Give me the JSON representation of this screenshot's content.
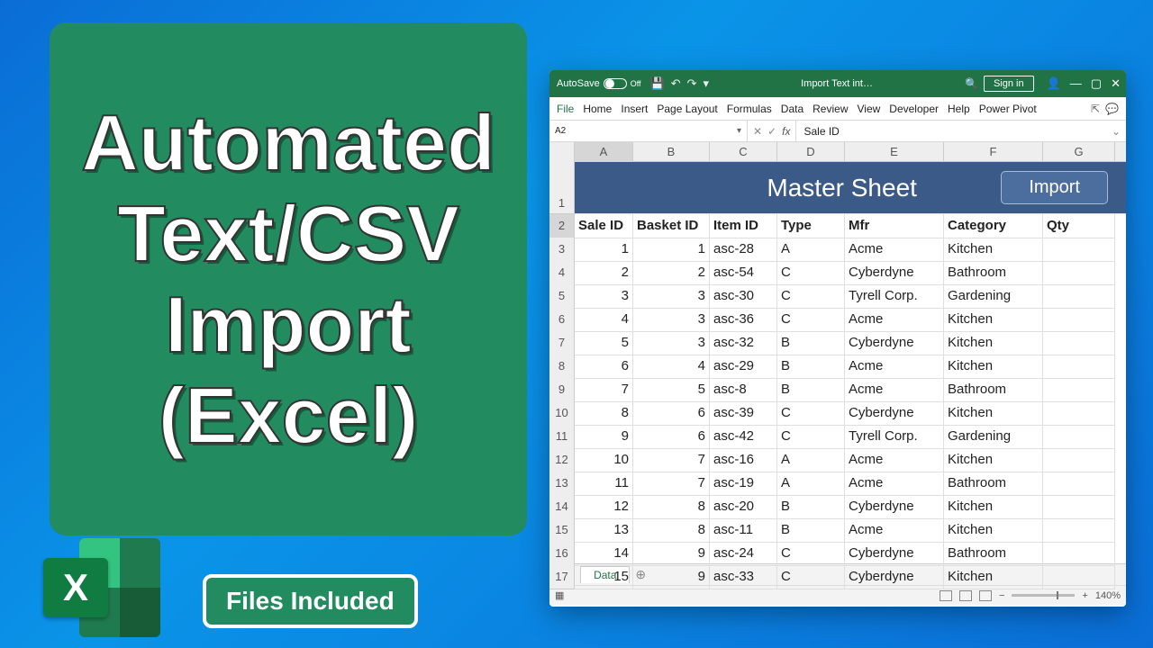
{
  "title_card": {
    "lines": [
      "Automated",
      "Text/CSV",
      "Import",
      "(Excel)"
    ]
  },
  "files_badge": "Files Included",
  "excel_logo_letter": "X",
  "excel": {
    "titlebar": {
      "autosave_label": "AutoSave",
      "autosave_state": "Off",
      "filename": "Import Text int…",
      "search_icon": "🔍",
      "signin": "Sign in",
      "qat": {
        "save": "💾",
        "undo": "↶",
        "redo": "↷",
        "more": "▾"
      },
      "win": {
        "user": "👤",
        "min": "—",
        "max": "▢",
        "close": "✕"
      }
    },
    "tabs": [
      "File",
      "Home",
      "Insert",
      "Page Layout",
      "Formulas",
      "Data",
      "Review",
      "View",
      "Developer",
      "Help",
      "Power Pivot"
    ],
    "formula": {
      "name_box": "A2",
      "fx_cancel": "✕",
      "fx_ok": "✓",
      "fx": "fx",
      "value": "Sale ID"
    },
    "columns": [
      "A",
      "B",
      "C",
      "D",
      "E",
      "F",
      "G"
    ],
    "master": {
      "title": "Master Sheet",
      "import": "Import"
    },
    "headers": [
      "Sale ID",
      "Basket ID",
      "Item ID",
      "Type",
      "Mfr",
      "Category",
      "Qty"
    ],
    "rows": [
      [
        "1",
        "1",
        "asc-28",
        "A",
        "Acme",
        "Kitchen",
        ""
      ],
      [
        "2",
        "2",
        "asc-54",
        "C",
        "Cyberdyne",
        "Bathroom",
        ""
      ],
      [
        "3",
        "3",
        "asc-30",
        "C",
        "Tyrell Corp.",
        "Gardening",
        ""
      ],
      [
        "4",
        "3",
        "asc-36",
        "C",
        "Acme",
        "Kitchen",
        ""
      ],
      [
        "5",
        "3",
        "asc-32",
        "B",
        "Cyberdyne",
        "Kitchen",
        ""
      ],
      [
        "6",
        "4",
        "asc-29",
        "B",
        "Acme",
        "Kitchen",
        ""
      ],
      [
        "7",
        "5",
        "asc-8",
        "B",
        "Acme",
        "Bathroom",
        ""
      ],
      [
        "8",
        "6",
        "asc-39",
        "C",
        "Cyberdyne",
        "Kitchen",
        ""
      ],
      [
        "9",
        "6",
        "asc-42",
        "C",
        "Tyrell Corp.",
        "Gardening",
        ""
      ],
      [
        "10",
        "7",
        "asc-16",
        "A",
        "Acme",
        "Kitchen",
        ""
      ],
      [
        "11",
        "7",
        "asc-19",
        "A",
        "Acme",
        "Bathroom",
        ""
      ],
      [
        "12",
        "8",
        "asc-20",
        "B",
        "Cyberdyne",
        "Kitchen",
        ""
      ],
      [
        "13",
        "8",
        "asc-11",
        "B",
        "Acme",
        "Kitchen",
        ""
      ],
      [
        "14",
        "9",
        "asc-24",
        "C",
        "Cyberdyne",
        "Bathroom",
        ""
      ],
      [
        "15",
        "9",
        "asc-33",
        "C",
        "Cyberdyne",
        "Kitchen",
        ""
      ]
    ],
    "sheet_tab": "Data",
    "status": {
      "ready_icon": "▦",
      "zoom": "140%"
    }
  }
}
